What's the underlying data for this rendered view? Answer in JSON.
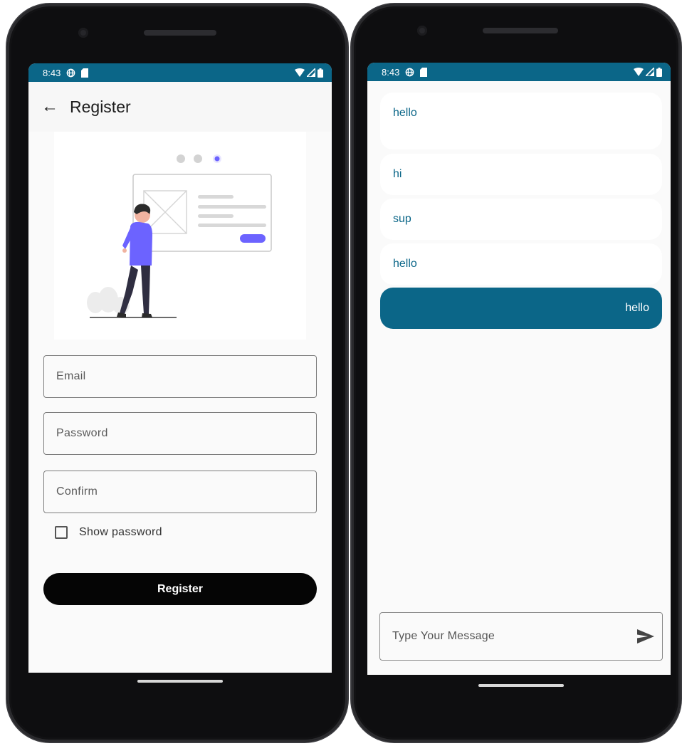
{
  "left_phone": {
    "status_bar": {
      "time": "8:43"
    },
    "appbar": {
      "back_icon": "arrow-left-icon",
      "title": "Register"
    },
    "form": {
      "email_placeholder": "Email",
      "password_placeholder": "Password",
      "confirm_placeholder": "Confirm",
      "show_password_label": "Show password",
      "show_password_checked": false,
      "register_label": "Register"
    },
    "illustration": {
      "page_indicator_dots": 3,
      "active_dot": 3
    }
  },
  "right_phone": {
    "status_bar": {
      "time": "8:43"
    },
    "messages": [
      {
        "text": "hello",
        "sent": false
      },
      {
        "text": "hi",
        "sent": false
      },
      {
        "text": "sup",
        "sent": false
      },
      {
        "text": "hello",
        "sent": false
      },
      {
        "text": "hello",
        "sent": true
      }
    ],
    "composer": {
      "placeholder": "Type Your Message",
      "send_icon": "send-icon"
    }
  },
  "colors": {
    "status_bar": "#0b6688",
    "accent": "#0b6688",
    "register_button": "#050505",
    "illustration_purple": "#6c63ff"
  }
}
